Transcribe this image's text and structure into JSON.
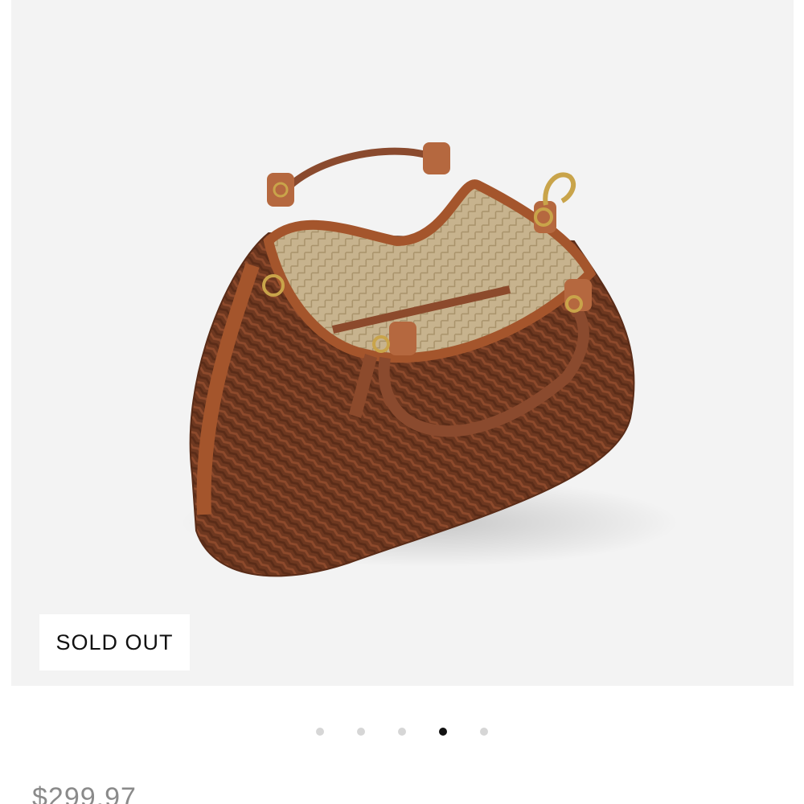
{
  "product": {
    "image_alt": "Woven leather hobo handbag",
    "badge": "SOLD OUT",
    "price": "$299.97"
  },
  "carousel": {
    "total": 5,
    "active_index": 3
  },
  "colors": {
    "panel_background": "#f3f3f3",
    "leather": "#7a3f26",
    "trim": "#a4552c",
    "lining": "#c8b48f",
    "hardware": "#c9a44a",
    "dot_inactive": "#d6d6d6",
    "dot_active": "#111111",
    "price_text": "#8a8a8a"
  }
}
